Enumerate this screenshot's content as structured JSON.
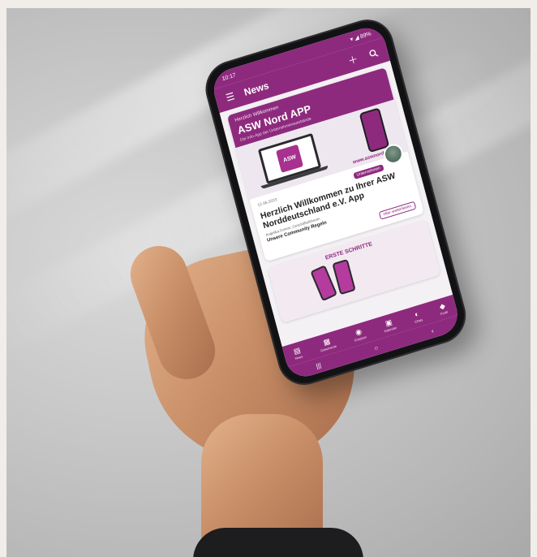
{
  "status_bar": {
    "time": "10:17",
    "indicators": "▾ ◢ 89%"
  },
  "app_bar": {
    "menu_icon": "hamburger-icon",
    "title": "News",
    "add_icon": "plus-icon",
    "search_icon": "search-icon"
  },
  "banner": {
    "greeting": "Herzlich Willkommen",
    "app_name": "ASW Nord APP",
    "tagline": "Die Info-App der Unternehmensverbände",
    "logo_text": "ASW",
    "url": "www.aswnord.de"
  },
  "article": {
    "date": "12.06.2023",
    "category": "Unternehmen",
    "headline": "Herzlich Willkommen zu Ihrer ASW Norddeutschland e.V. App",
    "author": "Angelika Grimm, Geschäftsführerin",
    "community": "Unsere Community Regeln",
    "read_more": "Hier weiterlesen"
  },
  "second_card": {
    "title": "ERSTE SCHRITTE"
  },
  "bottom_nav": [
    {
      "label": "News",
      "icon": "news-icon"
    },
    {
      "label": "Dokumente",
      "icon": "grid-icon"
    },
    {
      "label": "Gruppen",
      "icon": "group-icon"
    },
    {
      "label": "Kalender",
      "icon": "calendar-icon"
    },
    {
      "label": "Chats",
      "icon": "chat-icon"
    },
    {
      "label": "Profil",
      "icon": "profile-icon"
    }
  ],
  "system_nav": {
    "recents": "|||",
    "home": "○",
    "back": "‹"
  },
  "colors": {
    "brand": "#8e2a7e",
    "background": "#f4f1f4"
  }
}
